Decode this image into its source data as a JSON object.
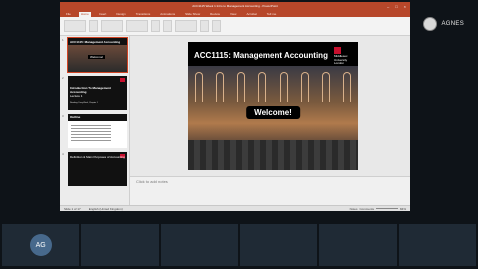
{
  "presenter": {
    "name": "AGNES"
  },
  "window": {
    "title": "ACC1115 Week 1 Intro to Management Accounting - PowerPoint"
  },
  "tabs": [
    "File",
    "Home",
    "Insert",
    "Design",
    "Transitions",
    "Animations",
    "Slide Show",
    "Review",
    "View",
    "Acrobat",
    "Tell me"
  ],
  "thumbnails": [
    {
      "num": "1",
      "title": "ACC1115: Management Accounting",
      "welcome": "Welcome!"
    },
    {
      "num": "2",
      "title": "Introduction To Management Accounting",
      "sub": "Lecture 1",
      "reading": "Reading: Drury/Seal, Chapter 1"
    },
    {
      "num": "3",
      "title": "Outline"
    },
    {
      "num": "4",
      "title": "Definition & Main Purposes of Accounting"
    }
  ],
  "slide": {
    "title": "ACC1115: Management Accounting",
    "welcome": "Welcome!",
    "logo_lines": [
      "Middlesex",
      "University",
      "London"
    ]
  },
  "notes": {
    "placeholder": "Click to add notes"
  },
  "status": {
    "slide": "Slide 1 of 17",
    "language": "English (United Kingdom)",
    "notes": "Notes",
    "comments": "Comments",
    "zoom": "84%"
  },
  "participants": [
    {
      "initials": "AG"
    },
    {
      "initials": ""
    },
    {
      "initials": ""
    },
    {
      "initials": ""
    },
    {
      "initials": ""
    },
    {
      "initials": ""
    }
  ],
  "colors": {
    "accent": "#b7472a",
    "brand": "#c8102e",
    "tile": "#1f2a35"
  }
}
